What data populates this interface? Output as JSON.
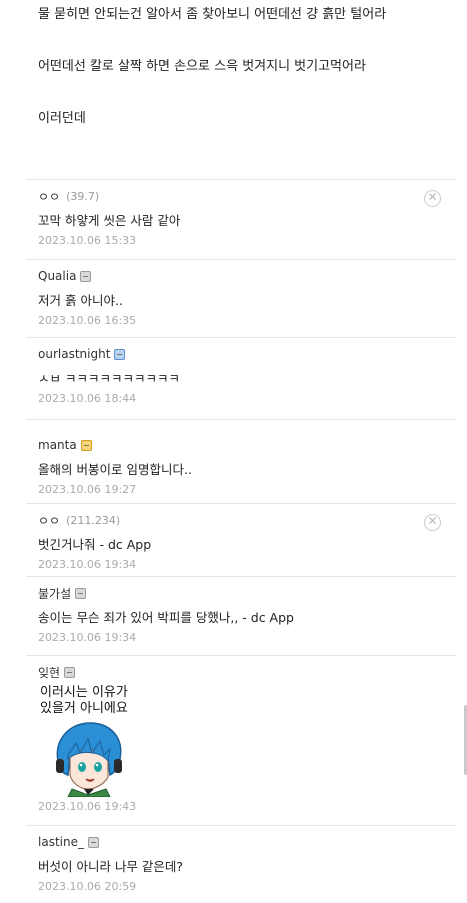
{
  "post": {
    "lines": [
      "물 묻히면 안되는건 알아서 좀 찾아보니 어떤데선 걍 흙만 털어라",
      "어떤데선 칼로 살짝 하면 손으로 스윽 벗겨지니 벗기고먹어라",
      "이러던데"
    ]
  },
  "comments": [
    {
      "nick": "ㅇㅇ",
      "ip": "(39.7)",
      "text": "꼬막 하얗게 씻은 사람 같아",
      "date": "2023.10.06 15:33",
      "deletable": true
    },
    {
      "nick": "Qualia",
      "icon": "gray",
      "text": "저거 흙 아니야..",
      "date": "2023.10.06 16:35"
    },
    {
      "nick": "ourlastnight",
      "icon": "blue",
      "text": "ㅅㅂ ㅋㅋㅋㅋㅋㅋㅋㅋㅋㅋ",
      "date": "2023.10.06 18:44"
    },
    {
      "nick": "manta",
      "icon": "gold",
      "text": "올해의 버봉이로 임명합니다..",
      "date": "2023.10.06 19:27"
    },
    {
      "nick": "ㅇㅇ",
      "ip": "(211.234)",
      "text": "벗긴거나줘 - dc App",
      "date": "2023.10.06 19:34",
      "deletable": true
    },
    {
      "nick": "불가설",
      "icon": "gray",
      "text": "송이는 무슨 죄가 있어 박피를 당했나,, - dc App",
      "date": "2023.10.06 19:34"
    },
    {
      "nick": "잊현",
      "icon": "gray",
      "dccon_caption": "이러시는 이유가\n있을거 아니에요",
      "date": "2023.10.06 19:43"
    },
    {
      "nick": "lastine_",
      "icon": "gray",
      "text": "버섯이 아니라 나무 같은데?",
      "date": "2023.10.06 20:59"
    }
  ],
  "icons": {
    "delete": "circle-x-icon",
    "member_gray": "member-badge-icon",
    "member_blue": "member-badge-blue-icon",
    "member_gold": "member-badge-gold-icon",
    "delete_glyph": "✕"
  }
}
